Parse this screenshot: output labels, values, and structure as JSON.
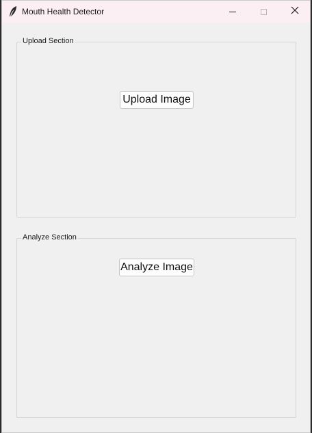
{
  "window": {
    "title": "Mouth Health Detector",
    "icon": "feather-icon",
    "controls": {
      "minimize": "minimize-icon",
      "maximize": "maximize-icon",
      "close": "close-icon"
    }
  },
  "upload_section": {
    "label": "Upload Section",
    "button_label": "Upload Image"
  },
  "analyze_section": {
    "label": "Analyze Section",
    "button_label": "Analyze Image"
  },
  "colors": {
    "titlebar": "#fbeff3",
    "window_bg": "#f0f0f0",
    "border": "#d4d4d4"
  }
}
